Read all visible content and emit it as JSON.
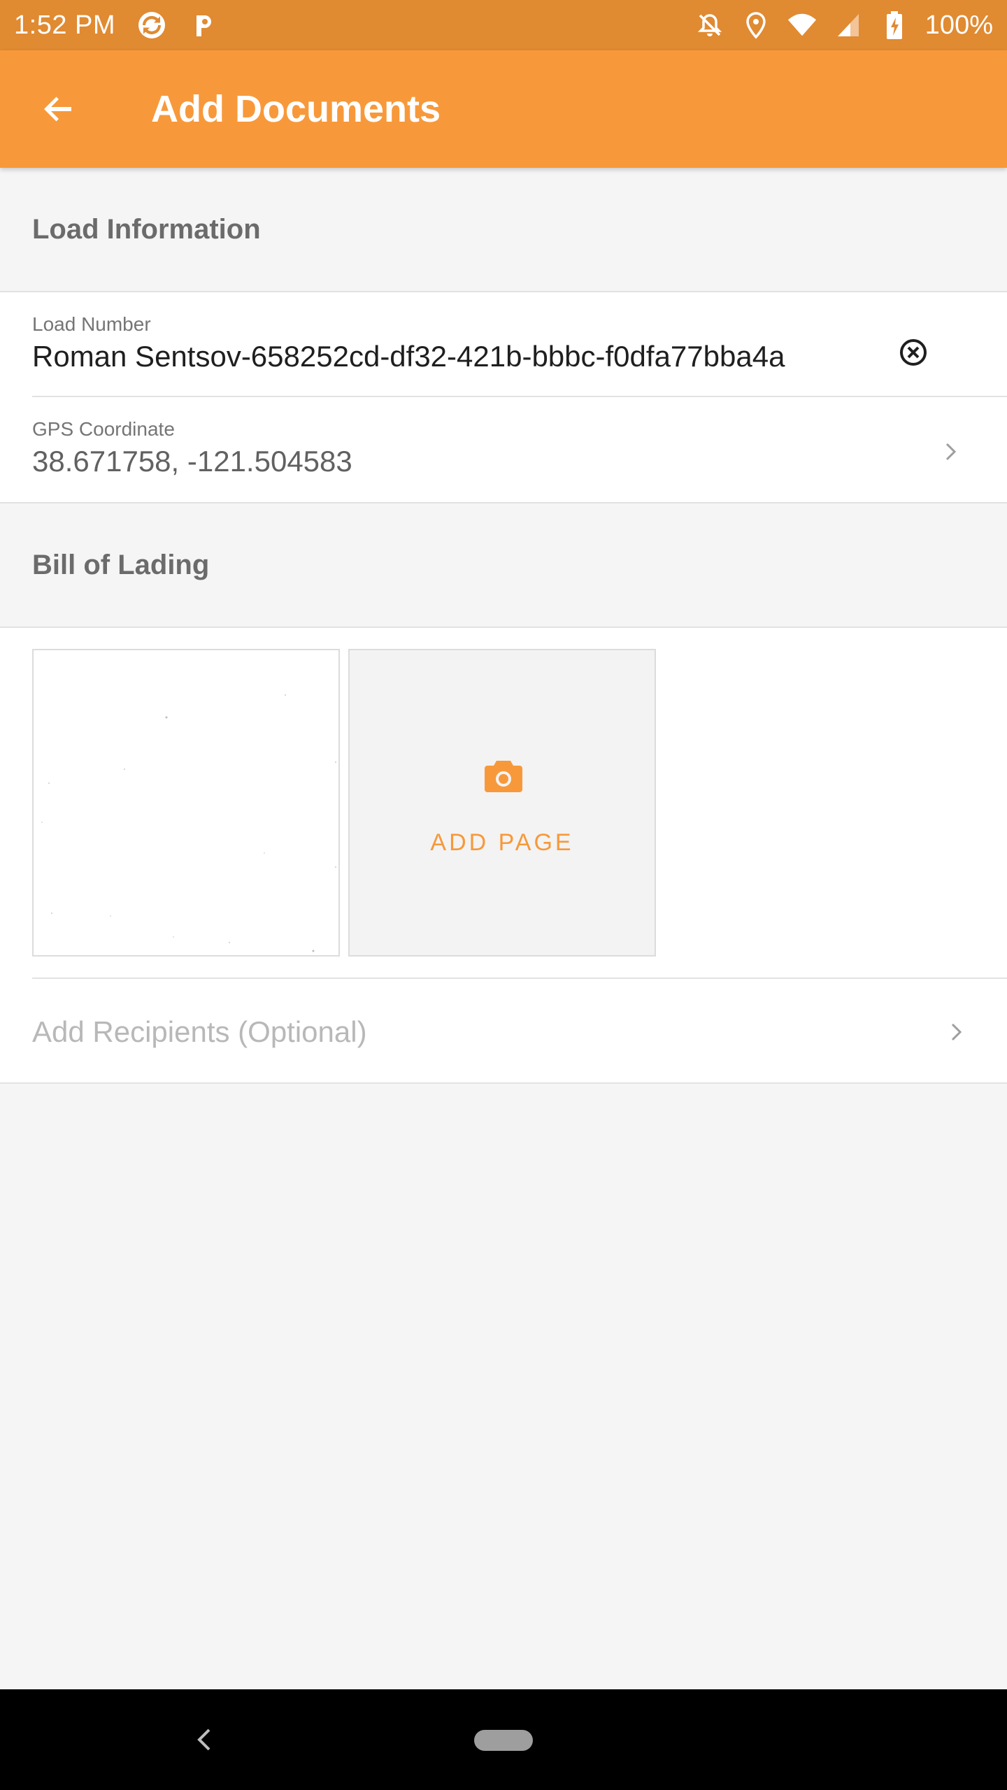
{
  "status_bar": {
    "time": "1:52 PM",
    "battery": "100%",
    "left_icons": [
      "sync-app-icon",
      "parking-app-icon"
    ],
    "right_icons": [
      "notifications-off-icon",
      "location-icon",
      "wifi-icon",
      "cell-signal-icon",
      "battery-charging-icon"
    ]
  },
  "app_bar": {
    "title": "Add Documents",
    "back_icon": "arrow-back-icon",
    "color": "#f7993a"
  },
  "load_information": {
    "header": "Load Information",
    "load_number": {
      "label": "Load Number",
      "value": "Roman Sentsov-658252cd-df32-421b-bbbc-f0dfa77bba4a"
    },
    "gps": {
      "label": "GPS Coordinate",
      "value": "38.671758, -121.504583"
    }
  },
  "bill_of_lading": {
    "header": "Bill of Lading",
    "add_page_label": "ADD PAGE",
    "recipients_label": "Add Recipients (Optional)"
  },
  "colors": {
    "accent": "#f7993a",
    "status_bar": "#e08a32",
    "background": "#f5f5f5"
  }
}
